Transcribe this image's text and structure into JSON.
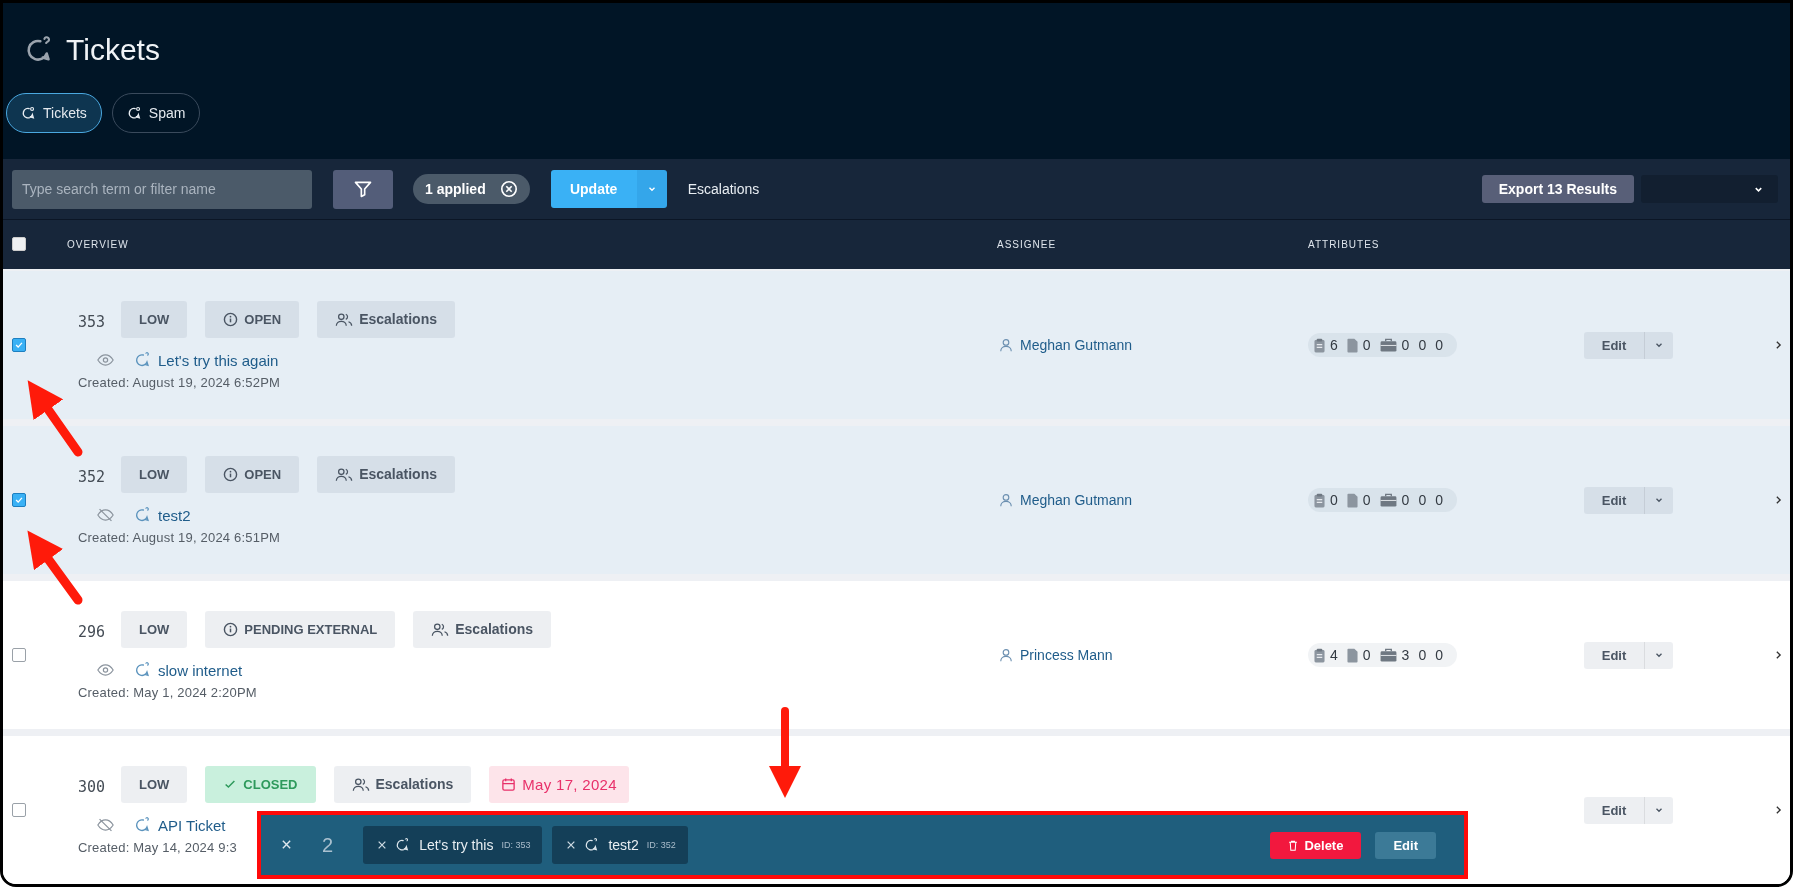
{
  "header": {
    "title": "Tickets"
  },
  "tabs": [
    {
      "label": "Tickets",
      "selected": true
    },
    {
      "label": "Spam",
      "selected": false
    }
  ],
  "toolbar": {
    "search": {
      "placeholder": "Type search term or filter name"
    },
    "filter_chip": "1 applied",
    "update_button": "Update",
    "view_name": "Escalations",
    "export_button": "Export 13 Results"
  },
  "table": {
    "select_all_checked": false,
    "columns": [
      "OVERVIEW",
      "ASSIGNEE",
      "ATTRIBUTES"
    ],
    "rows": [
      {
        "selected": true,
        "id": "353",
        "priority": "LOW",
        "status": {
          "kind": "open",
          "label": "OPEN"
        },
        "team": "Escalations",
        "watched": true,
        "title": "Let's try this again",
        "created": "Created: August 19, 2024 6:52PM",
        "assignee": "Meghan Gutmann",
        "attributes": [
          "6",
          "0",
          "0",
          "0",
          "0"
        ],
        "edit": "Edit"
      },
      {
        "selected": true,
        "id": "352",
        "priority": "LOW",
        "status": {
          "kind": "open",
          "label": "OPEN"
        },
        "team": "Escalations",
        "watched": false,
        "title": "test2",
        "created": "Created: August 19, 2024 6:51PM",
        "assignee": "Meghan Gutmann",
        "attributes": [
          "0",
          "0",
          "0",
          "0",
          "0"
        ],
        "edit": "Edit"
      },
      {
        "selected": false,
        "id": "296",
        "priority": "LOW",
        "status": {
          "kind": "open",
          "label": "PENDING EXTERNAL"
        },
        "team": "Escalations",
        "watched": true,
        "title": "slow internet",
        "created": "Created: May 1, 2024 2:20PM",
        "assignee": "Princess Mann",
        "attributes": [
          "4",
          "0",
          "3",
          "0",
          "0"
        ],
        "edit": "Edit"
      },
      {
        "selected": false,
        "id": "300",
        "priority": "LOW",
        "status": {
          "kind": "closed",
          "label": "CLOSED"
        },
        "team": "Escalations",
        "due": "May 17, 2024",
        "watched": false,
        "title": "API Ticket",
        "created": "Created: May 14, 2024 9:3",
        "edit": "Edit"
      }
    ]
  },
  "selection_bar": {
    "count": "2",
    "items": [
      {
        "title": "Let's try this",
        "id_label": "ID: 353"
      },
      {
        "title": "test2",
        "id_label": "ID: 352"
      }
    ],
    "delete_button": "Delete",
    "edit_button": "Edit"
  }
}
